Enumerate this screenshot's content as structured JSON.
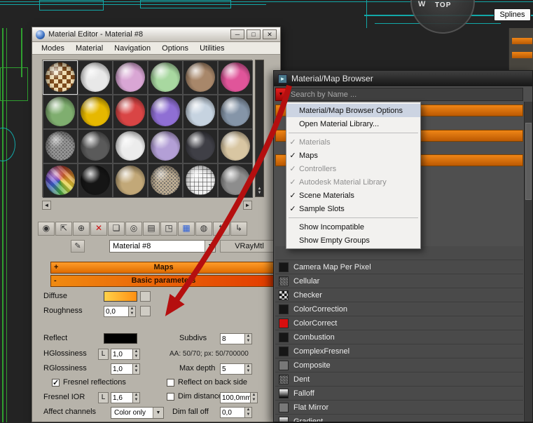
{
  "viewport": {
    "viewcube_top_label": "TOP",
    "compass_w_label": "W",
    "splines_button_label": "Splines"
  },
  "material_editor": {
    "window_title": "Material Editor - Material #8",
    "window_buttons": [
      {
        "name": "minimize-button",
        "glyph": "─"
      },
      {
        "name": "maximize-button",
        "glyph": "□"
      },
      {
        "name": "close-button",
        "glyph": "✕"
      }
    ],
    "menu_items": [
      "Modes",
      "Material",
      "Navigation",
      "Options",
      "Utilities"
    ],
    "samples": [
      {
        "type": "checker",
        "color": "#caa267",
        "active": true
      },
      {
        "type": "solid",
        "color": "#e8e8e8"
      },
      {
        "type": "solid",
        "color": "#d9a6d4"
      },
      {
        "type": "solid",
        "color": "#a8d8a0"
      },
      {
        "type": "solid",
        "color": "#a8876a"
      },
      {
        "type": "solid",
        "color": "#e0559a"
      },
      {
        "type": "solid",
        "color": "#7fae6f"
      },
      {
        "type": "solid",
        "color": "#e6b800"
      },
      {
        "type": "solid",
        "color": "#d94545"
      },
      {
        "type": "solid",
        "color": "#8f6fd4"
      },
      {
        "type": "solid",
        "color": "#c6d3e0"
      },
      {
        "type": "solid",
        "color": "#8595a8"
      },
      {
        "type": "noise",
        "color": "#9c9c9c"
      },
      {
        "type": "solid",
        "color": "#5a5a5a"
      },
      {
        "type": "solid",
        "color": "#ececec"
      },
      {
        "type": "solid",
        "color": "#b39fd6"
      },
      {
        "type": "solid",
        "color": "#3f3f46"
      },
      {
        "type": "solid",
        "color": "#d8c6a2"
      },
      {
        "type": "rainbow",
        "color": "#cc4488"
      },
      {
        "type": "solid",
        "color": "#151515"
      },
      {
        "type": "solid",
        "color": "#c2a878"
      },
      {
        "type": "noise",
        "color": "#cbb89a"
      },
      {
        "type": "wire",
        "color": "#f2f2f2"
      },
      {
        "type": "solid",
        "color": "#8d8d8d"
      }
    ],
    "toolbar_icons": [
      {
        "name": "get-material-icon",
        "glyph": "◉"
      },
      {
        "name": "put-material-to-scene-icon",
        "glyph": "⇱"
      },
      {
        "name": "assign-material-to-selection-icon",
        "glyph": "⊕"
      },
      {
        "name": "reset-material-icon",
        "glyph": "✕",
        "color": "#cc1111"
      },
      {
        "name": "make-material-copy-icon",
        "glyph": "❏"
      },
      {
        "name": "make-unique-icon",
        "glyph": "◎"
      },
      {
        "name": "put-to-library-icon",
        "glyph": "▤"
      },
      {
        "name": "material-id-channel-icon",
        "glyph": "◳"
      },
      {
        "name": "show-map-in-viewport-icon",
        "glyph": "▦",
        "color": "#2b5fd9"
      },
      {
        "name": "show-end-result-icon",
        "glyph": "◍"
      },
      {
        "name": "go-to-parent-icon",
        "glyph": "↰"
      },
      {
        "name": "go-forward-sibling-icon",
        "glyph": "↳"
      }
    ],
    "nav": {
      "left_arrow": "◄",
      "right_arrow": "►"
    },
    "picker_value": "Material #8",
    "type_button_label": "VRayMtl",
    "rollouts": {
      "maps_state": "+",
      "maps_label": "Maps",
      "basic_state": "-",
      "basic_label": "Basic parameters"
    },
    "params": {
      "diffuse_label": "Diffuse",
      "roughness_label": "Roughness",
      "roughness_value": "0,0",
      "reflect_label": "Reflect",
      "subdivs_label": "Subdivs",
      "subdivs_value": "8",
      "hglossiness_label": "HGlossiness",
      "hglossiness_lock": "L",
      "hglossiness_value": "1,0",
      "aa_info": "AA: 50/70; px: 50/700000",
      "rglossiness_label": "RGlossiness",
      "rglossiness_value": "1,0",
      "max_depth_label": "Max depth",
      "max_depth_value": "5",
      "fresnel_reflections_label": "Fresnel reflections",
      "reflect_back_label": "Reflect on back side",
      "fresnel_ior_label": "Fresnel IOR",
      "fresnel_ior_lock": "L",
      "fresnel_ior_value": "1,6",
      "dim_distance_label": "Dim distance",
      "dim_distance_value": "100,0mm",
      "affect_channels_label": "Affect channels",
      "affect_channels_value": "Color only",
      "dim_falloff_label": "Dim fall off",
      "dim_falloff_value": "0,0"
    }
  },
  "map_browser": {
    "window_title": "Material/Map Browser",
    "search_placeholder": "Search by Name ...",
    "menu_items": [
      {
        "label": "Material/Map Browser Options",
        "state": "highlighted"
      },
      {
        "label": "Open Material Library..."
      },
      {
        "separator": true
      },
      {
        "label": "Materials",
        "check": true,
        "disabled": true
      },
      {
        "label": "Maps",
        "check": true
      },
      {
        "label": "Controllers",
        "check": true,
        "disabled": true
      },
      {
        "label": "Autodesk Material Library",
        "check": true,
        "disabled": true
      },
      {
        "label": "Scene Materials",
        "check": true
      },
      {
        "label": "Sample Slots",
        "check": true
      },
      {
        "separator": true
      },
      {
        "label": "Show Incompatible"
      },
      {
        "label": "Show Empty Groups"
      }
    ],
    "map_list": [
      {
        "label": "",
        "icon": "none"
      },
      {
        "label": "Camera Map Per Pixel",
        "icon": "dark"
      },
      {
        "label": "Cellular",
        "icon": "noise"
      },
      {
        "label": "Checker",
        "icon": "checker"
      },
      {
        "label": "ColorCorrection",
        "icon": "dark"
      },
      {
        "label": "ColorCorrect",
        "icon": "red"
      },
      {
        "label": "Combustion",
        "icon": "dark"
      },
      {
        "label": "ComplexFresnel",
        "icon": "dark"
      },
      {
        "label": "Composite",
        "icon": "gray"
      },
      {
        "label": "Dent",
        "icon": "noise"
      },
      {
        "label": "Falloff",
        "icon": "falloff"
      },
      {
        "label": "Flat Mirror",
        "icon": "gray"
      },
      {
        "label": "Gradient",
        "icon": "gradient"
      }
    ]
  },
  "colors": {
    "accent_orange": "#ef8516",
    "annotation_red": "#b50f0f"
  }
}
